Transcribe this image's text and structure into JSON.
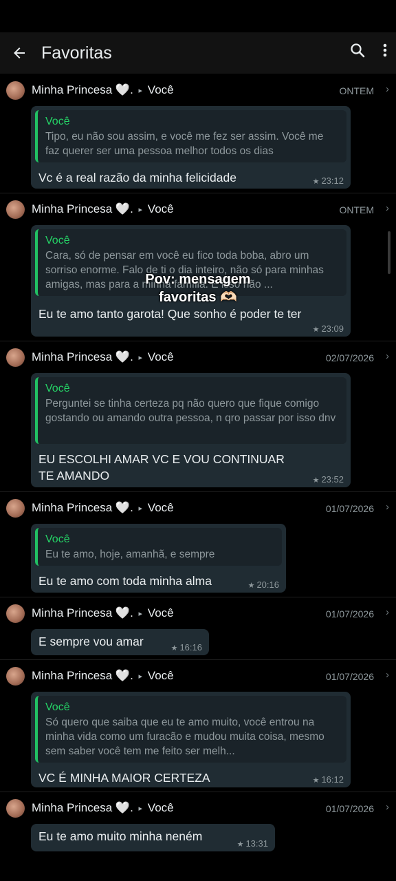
{
  "header": {
    "title": "Favoritas",
    "back_icon": "arrow-left-icon",
    "search_icon": "search-icon",
    "menu_icon": "more-vert-icon"
  },
  "entries": [
    {
      "sender": "Minha Princesa",
      "emoji": "🤍.",
      "recipient": "Você",
      "date": "ONTEM",
      "quote_name": "Você",
      "quote_text": "Tipo, eu não sou assim, e você me fez ser assim. Você me faz querer ser uma pessoa melhor todos os dias",
      "message": "Vc é a real razão da minha felicidade",
      "time": "23:12"
    },
    {
      "sender": "Minha Princesa",
      "emoji": "🤍.",
      "recipient": "Você",
      "date": "ONTEM",
      "quote_name": "Você",
      "quote_text": "Cara, só de pensar em você eu fico toda boba, abro um sorriso enorme. Falo de ti o dia inteiro, não só para minhas amigas, mas para a minha família. E isso não ...",
      "message": "Eu te amo tanto garota! Que sonho é poder te ter",
      "time": "23:09"
    },
    {
      "sender": "Minha Princesa",
      "emoji": "🤍.",
      "recipient": "Você",
      "date": "02/07/2026",
      "quote_name": "Você",
      "quote_text": "Perguntei se tinha certeza pq não quero que fique comigo gostando ou amando outra pessoa, n qro passar por isso dnv",
      "message": "EU ESCOLHI AMAR VC E VOU CONTINUAR TE AMANDO",
      "time": "23:52"
    },
    {
      "sender": "Minha Princesa",
      "emoji": "🤍.",
      "recipient": "Você",
      "date": "01/07/2026",
      "quote_name": "Você",
      "quote_text": "Eu te amo, hoje, amanhã, e sempre",
      "message": "Eu te amo com toda minha alma",
      "time": "20:16"
    },
    {
      "sender": "Minha Princesa",
      "emoji": "🤍.",
      "recipient": "Você",
      "date": "01/07/2026",
      "message": "E sempre vou amar",
      "time": "16:16"
    },
    {
      "sender": "Minha Princesa",
      "emoji": "🤍.",
      "recipient": "Você",
      "date": "01/07/2026",
      "quote_name": "Você",
      "quote_text": "Só quero que saiba que eu te amo muito, você entrou na minha vida como um furacão e mudou muita coisa, mesmo sem saber você tem me feito ser melh...",
      "message": "VC É MINHA MAIOR CERTEZA",
      "time": "16:12"
    },
    {
      "sender": "Minha Princesa",
      "emoji": "🤍.",
      "recipient": "Você",
      "date": "01/07/2026",
      "message": "Eu te amo muito minha neném",
      "time": "13:31"
    }
  ],
  "overlay": {
    "line1": "Pov: mensagem",
    "line2": "favoritas 🫶🏻"
  }
}
